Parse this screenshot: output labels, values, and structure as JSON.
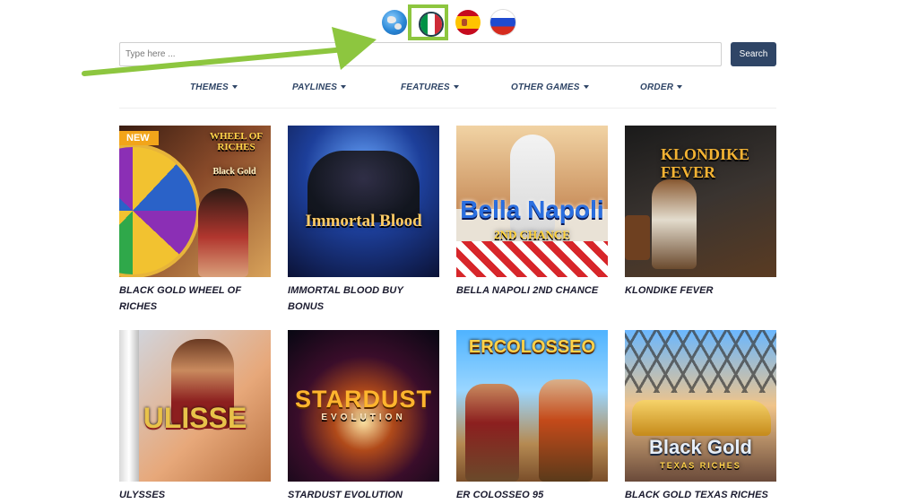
{
  "languages": [
    {
      "name": "globe-icon"
    },
    {
      "name": "italian-flag-icon",
      "selected": true,
      "highlight_color": "#8dc63f"
    },
    {
      "name": "spanish-flag-icon"
    },
    {
      "name": "russian-flag-icon"
    }
  ],
  "search": {
    "placeholder": "Type here ...",
    "button_label": "Search",
    "button_color": "#2f4566"
  },
  "menu": [
    {
      "label": "THEMES"
    },
    {
      "label": "PAYLINES"
    },
    {
      "label": "FEATURES"
    },
    {
      "label": "OTHER GAMES"
    },
    {
      "label": "ORDER"
    }
  ],
  "annotation": {
    "arrow_color": "#8dc63f"
  },
  "games": [
    {
      "title": "BLACK GOLD WHEEL OF RICHES",
      "badge": "NEW",
      "art_text": "WHEEL OF RICHES",
      "art_subtext": "Black Gold"
    },
    {
      "title": "IMMORTAL BLOOD BUY BONUS",
      "art_text": "Immortal Blood"
    },
    {
      "title": "BELLA NAPOLI 2ND CHANCE",
      "art_text": "Bella Napoli",
      "art_subtext": "2ND CHANCE"
    },
    {
      "title": "KLONDIKE FEVER",
      "art_text": "KLONDIKE FEVER"
    },
    {
      "title": "ULYSSES",
      "art_text": "ULISSE"
    },
    {
      "title": "STARDUST EVOLUTION",
      "art_text": "STARDUST",
      "art_subtext": "EVOLUTION"
    },
    {
      "title": "ER COLOSSEO 95",
      "art_text": "ERCOLOSSEO"
    },
    {
      "title": "BLACK GOLD TEXAS RICHES",
      "art_text": "Black Gold",
      "art_subtext": "TEXAS RICHES"
    }
  ]
}
